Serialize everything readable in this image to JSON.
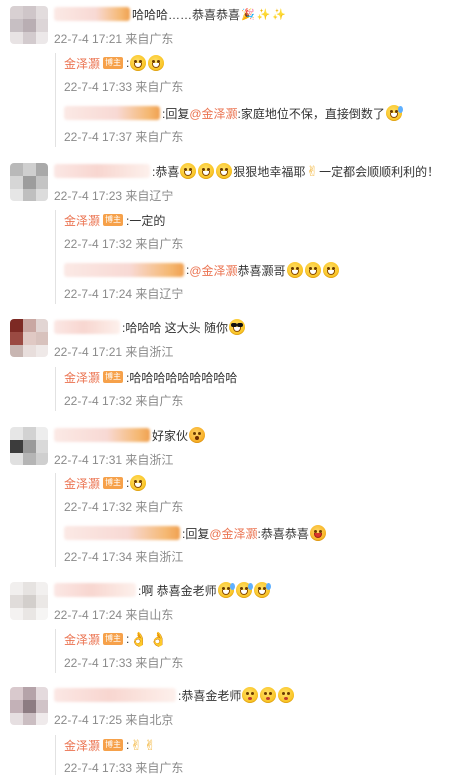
{
  "comments": [
    {
      "text_before": "哈哈哈……恭喜恭喜",
      "time": "22-7-4 17:21",
      "location": "来自广东",
      "replies": [
        {
          "author": "金泽灏",
          "badge": "博主",
          "text": ":",
          "time": "22-7-4 17:33",
          "location": "来自广东"
        },
        {
          "prefix": ":回复",
          "mention": "@金泽灏",
          "text": ":家庭地位不保，直接倒数了",
          "time": "22-7-4 17:37",
          "location": "来自广东"
        }
      ]
    },
    {
      "text_before": ":恭喜",
      "text_after": "狠狠地幸福耶",
      "text_end": "一定都会顺顺利利的！",
      "time": "22-7-4 17:23",
      "location": "来自辽宁",
      "replies": [
        {
          "author": "金泽灏",
          "badge": "博主",
          "text": ":一定的",
          "time": "22-7-4 17:32",
          "location": "来自广东"
        },
        {
          "prefix": ":",
          "mention": "@金泽灏",
          "text": " 恭喜灏哥",
          "time": "22-7-4 17:24",
          "location": "来自辽宁"
        }
      ]
    },
    {
      "text_before": ":哈哈哈 这大头 随你",
      "time": "22-7-4 17:21",
      "location": "来自浙江",
      "replies": [
        {
          "author": "金泽灏",
          "badge": "博主",
          "text": ":哈哈哈哈哈哈哈哈哈",
          "time": "22-7-4 17:32",
          "location": "来自广东"
        }
      ]
    },
    {
      "text_before": "好家伙",
      "time": "22-7-4 17:31",
      "location": "来自浙江",
      "replies": [
        {
          "author": "金泽灏",
          "badge": "博主",
          "text": ":",
          "time": "22-7-4 17:32",
          "location": "来自广东"
        },
        {
          "prefix": ":回复",
          "mention": "@金泽灏",
          "text": ":恭喜恭喜",
          "time": "22-7-4 17:34",
          "location": "来自浙江"
        }
      ]
    },
    {
      "text_before": ":啊 恭喜金老师",
      "time": "22-7-4 17:24",
      "location": "来自山东",
      "replies": [
        {
          "author": "金泽灏",
          "badge": "博主",
          "text": ":",
          "time": "22-7-4 17:33",
          "location": "来自广东"
        }
      ]
    },
    {
      "text_before": ":恭喜金老师",
      "time": "22-7-4 17:25",
      "location": "来自北京",
      "replies": [
        {
          "author": "金泽灏",
          "badge": "博主",
          "text": ":",
          "time": "22-7-4 17:33",
          "location": "来自广东"
        }
      ]
    }
  ]
}
